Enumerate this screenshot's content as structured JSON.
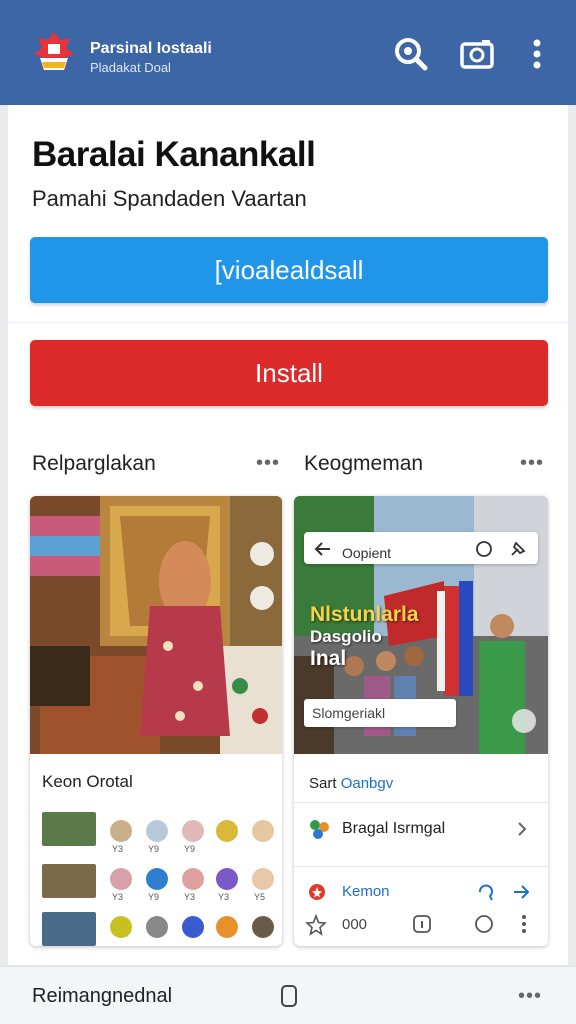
{
  "header": {
    "brand_line1": "Parsinal Iostaali",
    "brand_line2": "Pladakat Doal",
    "icons": [
      "flag-logo-icon",
      "search-icon",
      "camera-icon",
      "more-vertical-icon"
    ]
  },
  "app": {
    "title": "Baralai Kanankall",
    "subtitle": "Pamahi Spandaden Vaartan",
    "open_button": "[vioalealdsall",
    "install_button": "Install"
  },
  "sections": {
    "left_title": "Relparglakan",
    "right_title": "Keogmeman"
  },
  "left_card": {
    "caption": "Keon Orotal",
    "thumb_labels": [
      [
        "Y3",
        "Y9",
        "Y9",
        "",
        ""
      ],
      [
        "Y3",
        "Y9",
        "Y3",
        "Y3",
        "Y5"
      ],
      [
        "",
        "",
        "",
        "",
        ""
      ]
    ]
  },
  "right_card": {
    "overlay_search_text": "Oopient",
    "headline_line1": "Nlstunlarla",
    "headline_line2": "Dasgolio",
    "headline_line3": "Inal",
    "search_box_text": "Slomgeriakl",
    "row1_prefix": "Sart",
    "row1_accent": "Oanbgv",
    "row2_text": "Bragal Isrmgal",
    "row3_text": "Kemon",
    "row4_text": "000"
  },
  "bottom": {
    "label": "Reimangnednal"
  },
  "colors": {
    "header_bg": "#3d66a6",
    "open_button": "#2196e8",
    "install_button": "#dc2a2a",
    "accent_link": "#1d6fcf"
  }
}
